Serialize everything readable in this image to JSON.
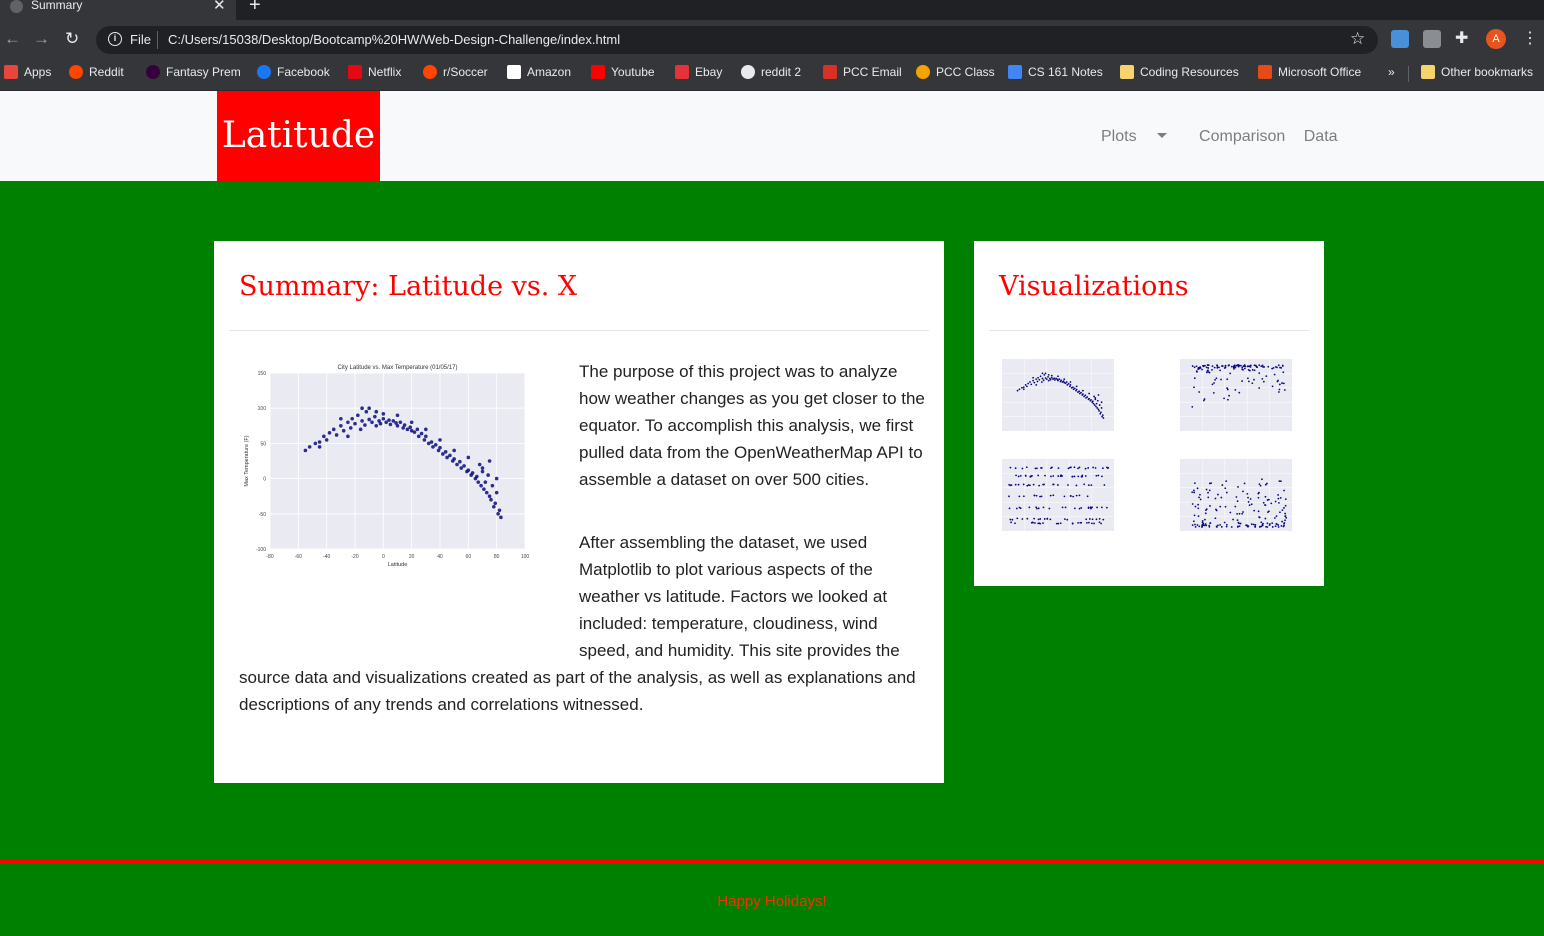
{
  "browser": {
    "tab_title": "Summary",
    "new_tab_symbol": "+",
    "url_scheme": "File",
    "url": "C:/Users/15038/Desktop/Bootcamp%20HW/Web-Design-Challenge/index.html",
    "avatar_letter": "A",
    "bookmarks": [
      {
        "label": "Apps",
        "color": "#e8453c"
      },
      {
        "label": "Reddit",
        "color": "#ff4500"
      },
      {
        "label": "Fantasy Prem",
        "color": "#37003c"
      },
      {
        "label": "Facebook",
        "color": "#1877f2"
      },
      {
        "label": "Netflix",
        "color": "#e50914"
      },
      {
        "label": "r/Soccer",
        "color": "#ff4500"
      },
      {
        "label": "Amazon",
        "color": "#ffffff"
      },
      {
        "label": "Youtube",
        "color": "#ff0000"
      },
      {
        "label": "Ebay",
        "color": "#e53238"
      },
      {
        "label": "reddit 2",
        "color": "#e8eaed"
      },
      {
        "label": "PCC Email",
        "color": "#d93025"
      },
      {
        "label": "PCC Class",
        "color": "#f4a300"
      },
      {
        "label": "CS 161 Notes",
        "color": "#4285f4"
      },
      {
        "label": "Coding Resources",
        "color": "#f6d36b"
      },
      {
        "label": "Microsoft Office",
        "color": "#e64a19"
      }
    ],
    "overflow": "»",
    "other_bookmarks": "Other bookmarks"
  },
  "site": {
    "brand": "Latitude",
    "nav": {
      "plots": "Plots",
      "comparison": "Comparison",
      "data": "Data"
    },
    "colors": {
      "brand": "#ff0000",
      "background": "#008000",
      "navbar": "#f8f9fa"
    }
  },
  "summary": {
    "heading": "Summary: Latitude vs. X",
    "paragraph1": "The purpose of this project was to analyze how weather changes as you get closer to the equator. To accomplish this analysis, we first pulled data from the OpenWeatherMap API to assemble a dataset on over 500 cities.",
    "paragraph2": "After assembling the dataset, we used Matplotlib to plot various aspects of the weather vs latitude. Factors we looked at included: temperature, cloudiness, wind speed, and humidity. This site provides the source data and visualizations created as part of the analysis, as well as explanations and descriptions of any trends and correlations witnessed."
  },
  "visualizations": {
    "heading": "Visualizations"
  },
  "footer": {
    "text": "Happy Holidays!"
  },
  "chart_data": {
    "type": "scatter",
    "title": "City Latitude vs. Max Temperature (01/05/17)",
    "xlabel": "Latitude",
    "ylabel": "Max Temperature (F)",
    "xlim": [
      -80,
      100
    ],
    "ylim": [
      -100,
      150
    ],
    "xticks": [
      -80,
      -60,
      -40,
      -20,
      0,
      20,
      40,
      60,
      80,
      100
    ],
    "yticks": [
      -100,
      -50,
      0,
      50,
      100,
      150
    ],
    "grid": true,
    "points": [
      [
        -55,
        40
      ],
      [
        -52,
        45
      ],
      [
        -48,
        50
      ],
      [
        -45,
        52
      ],
      [
        -42,
        60
      ],
      [
        -40,
        55
      ],
      [
        -38,
        65
      ],
      [
        -35,
        70
      ],
      [
        -33,
        62
      ],
      [
        -30,
        75
      ],
      [
        -28,
        68
      ],
      [
        -25,
        80
      ],
      [
        -23,
        72
      ],
      [
        -22,
        85
      ],
      [
        -20,
        78
      ],
      [
        -18,
        90
      ],
      [
        -16,
        70
      ],
      [
        -15,
        82
      ],
      [
        -13,
        76
      ],
      [
        -12,
        95
      ],
      [
        -10,
        84
      ],
      [
        -8,
        80
      ],
      [
        -6,
        88
      ],
      [
        -5,
        75
      ],
      [
        -3,
        82
      ],
      [
        -2,
        78
      ],
      [
        0,
        85
      ],
      [
        2,
        80
      ],
      [
        4,
        83
      ],
      [
        5,
        77
      ],
      [
        7,
        82
      ],
      [
        9,
        79
      ],
      [
        10,
        75
      ],
      [
        12,
        80
      ],
      [
        14,
        72
      ],
      [
        15,
        76
      ],
      [
        17,
        70
      ],
      [
        19,
        73
      ],
      [
        20,
        68
      ],
      [
        22,
        66
      ],
      [
        24,
        70
      ],
      [
        25,
        60
      ],
      [
        27,
        64
      ],
      [
        29,
        55
      ],
      [
        30,
        60
      ],
      [
        32,
        50
      ],
      [
        34,
        52
      ],
      [
        35,
        45
      ],
      [
        37,
        48
      ],
      [
        39,
        40
      ],
      [
        40,
        44
      ],
      [
        42,
        35
      ],
      [
        44,
        38
      ],
      [
        45,
        30
      ],
      [
        47,
        33
      ],
      [
        49,
        25
      ],
      [
        50,
        28
      ],
      [
        52,
        20
      ],
      [
        54,
        24
      ],
      [
        55,
        15
      ],
      [
        57,
        18
      ],
      [
        59,
        10
      ],
      [
        60,
        12
      ],
      [
        62,
        5
      ],
      [
        63,
        8
      ],
      [
        65,
        0
      ],
      [
        66,
        3
      ],
      [
        67,
        -5
      ],
      [
        68,
        20
      ],
      [
        69,
        -10
      ],
      [
        70,
        10
      ],
      [
        71,
        -15
      ],
      [
        72,
        -5
      ],
      [
        73,
        -20
      ],
      [
        74,
        5
      ],
      [
        75,
        -25
      ],
      [
        76,
        -30
      ],
      [
        77,
        -10
      ],
      [
        78,
        -40
      ],
      [
        79,
        -35
      ],
      [
        80,
        -20
      ],
      [
        81,
        -50
      ],
      [
        82,
        -45
      ],
      [
        83,
        -55
      ],
      [
        -45,
        45
      ],
      [
        -25,
        60
      ],
      [
        -15,
        100
      ],
      [
        -5,
        95
      ],
      [
        10,
        90
      ],
      [
        20,
        80
      ],
      [
        30,
        70
      ],
      [
        40,
        55
      ],
      [
        50,
        40
      ],
      [
        60,
        30
      ],
      [
        70,
        15
      ],
      [
        75,
        25
      ],
      [
        80,
        0
      ],
      [
        -30,
        85
      ],
      [
        -10,
        100
      ],
      [
        0,
        92
      ]
    ]
  }
}
